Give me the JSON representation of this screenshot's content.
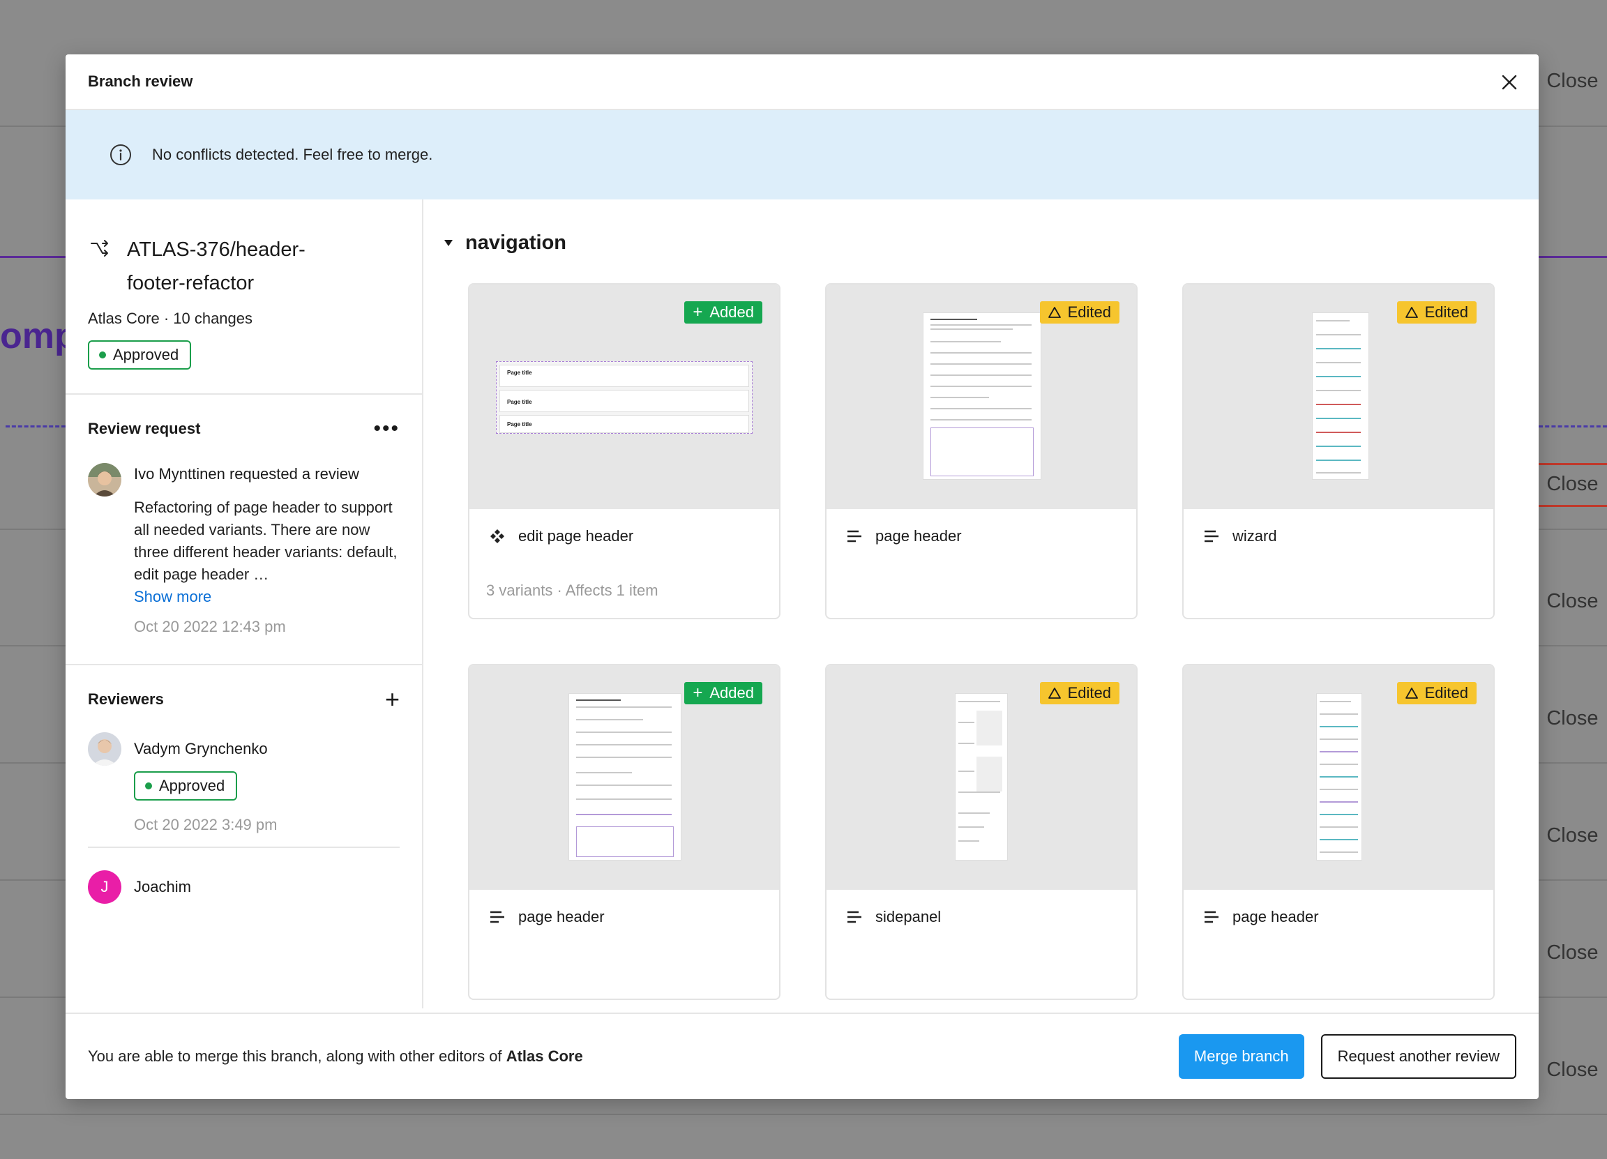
{
  "background": {
    "partial_heading": "ompo",
    "close_label": "Close"
  },
  "modal": {
    "title": "Branch review",
    "banner": "No conflicts detected. Feel free to merge."
  },
  "branch": {
    "name": "ATLAS-376/header-footer-refactor",
    "meta": "Atlas Core · 10 changes",
    "status": "Approved"
  },
  "review_request": {
    "title": "Review request",
    "requester": "Ivo Mynttinen",
    "action": "requested a review",
    "message": "Refactoring of page header to support all needed variants. There are now three different header variants: default, edit page header …",
    "show_more": "Show more",
    "date": "Oct 20 2022 12:43 pm"
  },
  "reviewers": {
    "title": "Reviewers",
    "items": [
      {
        "name": "Vadym Grynchenko",
        "status": "Approved",
        "date": "Oct 20 2022 3:49 pm"
      },
      {
        "name": "Joachim",
        "initial": "J"
      }
    ]
  },
  "group": {
    "title": "navigation"
  },
  "cards": [
    {
      "label": "edit page header",
      "status": "Added",
      "icon": "component-icon",
      "sub": "3 variants · Affects 1 item",
      "thumb_text": "Page title"
    },
    {
      "label": "page header",
      "status": "Edited",
      "icon": "text-lines-icon"
    },
    {
      "label": "wizard",
      "status": "Edited",
      "icon": "text-lines-icon"
    },
    {
      "label": "page header",
      "status": "Added",
      "icon": "text-lines-icon"
    },
    {
      "label": "sidepanel",
      "status": "Edited",
      "icon": "text-lines-icon"
    },
    {
      "label": "page header",
      "status": "Edited",
      "icon": "text-lines-icon"
    }
  ],
  "footer": {
    "text": "You are able to merge this branch, along with other editors of",
    "project": "Atlas Core",
    "merge_label": "Merge branch",
    "request_label": "Request another review"
  },
  "colors": {
    "added": "#15a750",
    "edited": "#f6c52e",
    "banner": "#ddeefa",
    "primary": "#1a98f0",
    "approved": "#1b9e4b"
  }
}
